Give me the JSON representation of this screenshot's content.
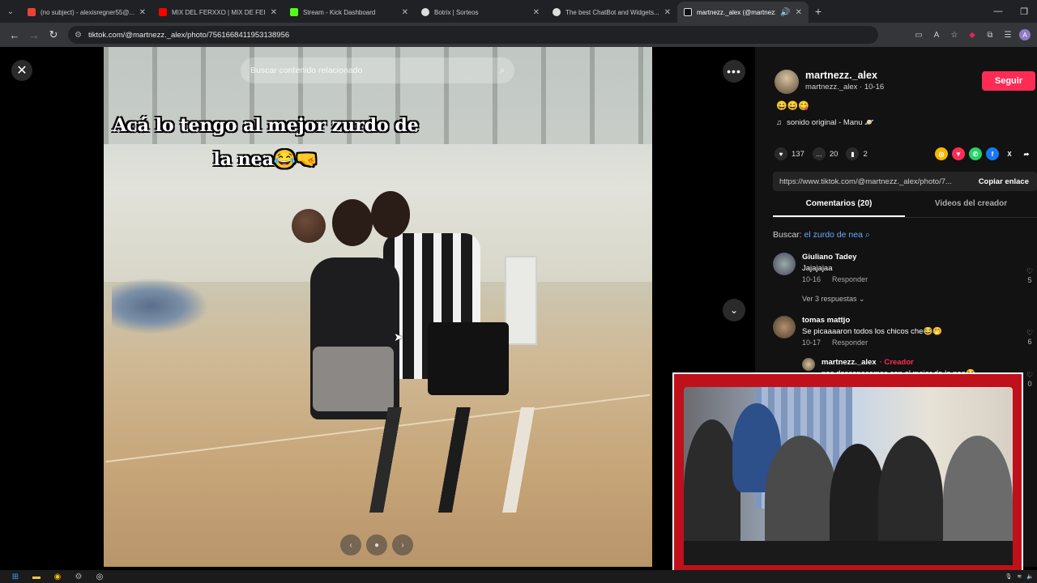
{
  "browser": {
    "tabs": [
      {
        "title": "(no subject) - alexisregner55@...",
        "favicon": "gmail-icon",
        "color": "#ea4335",
        "active": false
      },
      {
        "title": "MIX DEL FERXXO | MIX DE FEID...",
        "favicon": "youtube-icon",
        "color": "#ff0000",
        "active": false
      },
      {
        "title": "Stream - Kick Dashboard",
        "favicon": "kick-icon",
        "color": "#53fc18",
        "active": false
      },
      {
        "title": "Botrix | Sorteos",
        "favicon": "botrix-icon",
        "color": "#ffffff",
        "active": false
      },
      {
        "title": "The best ChatBot and Widgets...",
        "favicon": "chatbot-icon",
        "color": "#ffffff",
        "active": false
      },
      {
        "title": "martnezz._alex (@martnezz...",
        "favicon": "tiktok-icon",
        "color": "#ffffff",
        "active": true
      }
    ],
    "url": "tiktok.com/@martnezz._alex/photo/7561668411953138956",
    "profile_initial": "A"
  },
  "viewer": {
    "search_placeholder": "Buscar contenido relacionado",
    "caption_line1": "Acá lo tengo al mejor zurdo de",
    "caption_line2": "la nea😂🤜"
  },
  "post": {
    "username": "martnezz._alex",
    "subline": "martnezz._alex · 10-16",
    "follow_label": "Seguir",
    "description": "😄😄😋",
    "sound": "sonido original - Manu 🪐",
    "likes": "137",
    "comments": "20",
    "saves": "2",
    "share_link": "https://www.tiktok.com/@martnezz._alex/photo/7...",
    "copy_label": "Copiar enlace",
    "tab_comments": "Comentarios (20)",
    "tab_videos": "Videos del creador",
    "search_prefix": "Buscar:",
    "search_query": "el zurdo de nea"
  },
  "comments": [
    {
      "name": "Giuliano Tadey",
      "text": "Jajajajaa",
      "date": "10-16",
      "reply": "Responder",
      "likes": "5"
    },
    {
      "name": "tomas mattjo",
      "text": "Se picaaaaron todos los chicos che😂🤭",
      "date": "10-17",
      "reply": "Responder",
      "likes": "6"
    },
    {
      "name": "martnezz._alex",
      "creator": "· Creador",
      "text": "nos desconocemos con el mejor de la nea😂",
      "likes": "0"
    }
  ],
  "replies_label": "Ver 3 respuestas ⌄",
  "accent": "#fe2c55"
}
